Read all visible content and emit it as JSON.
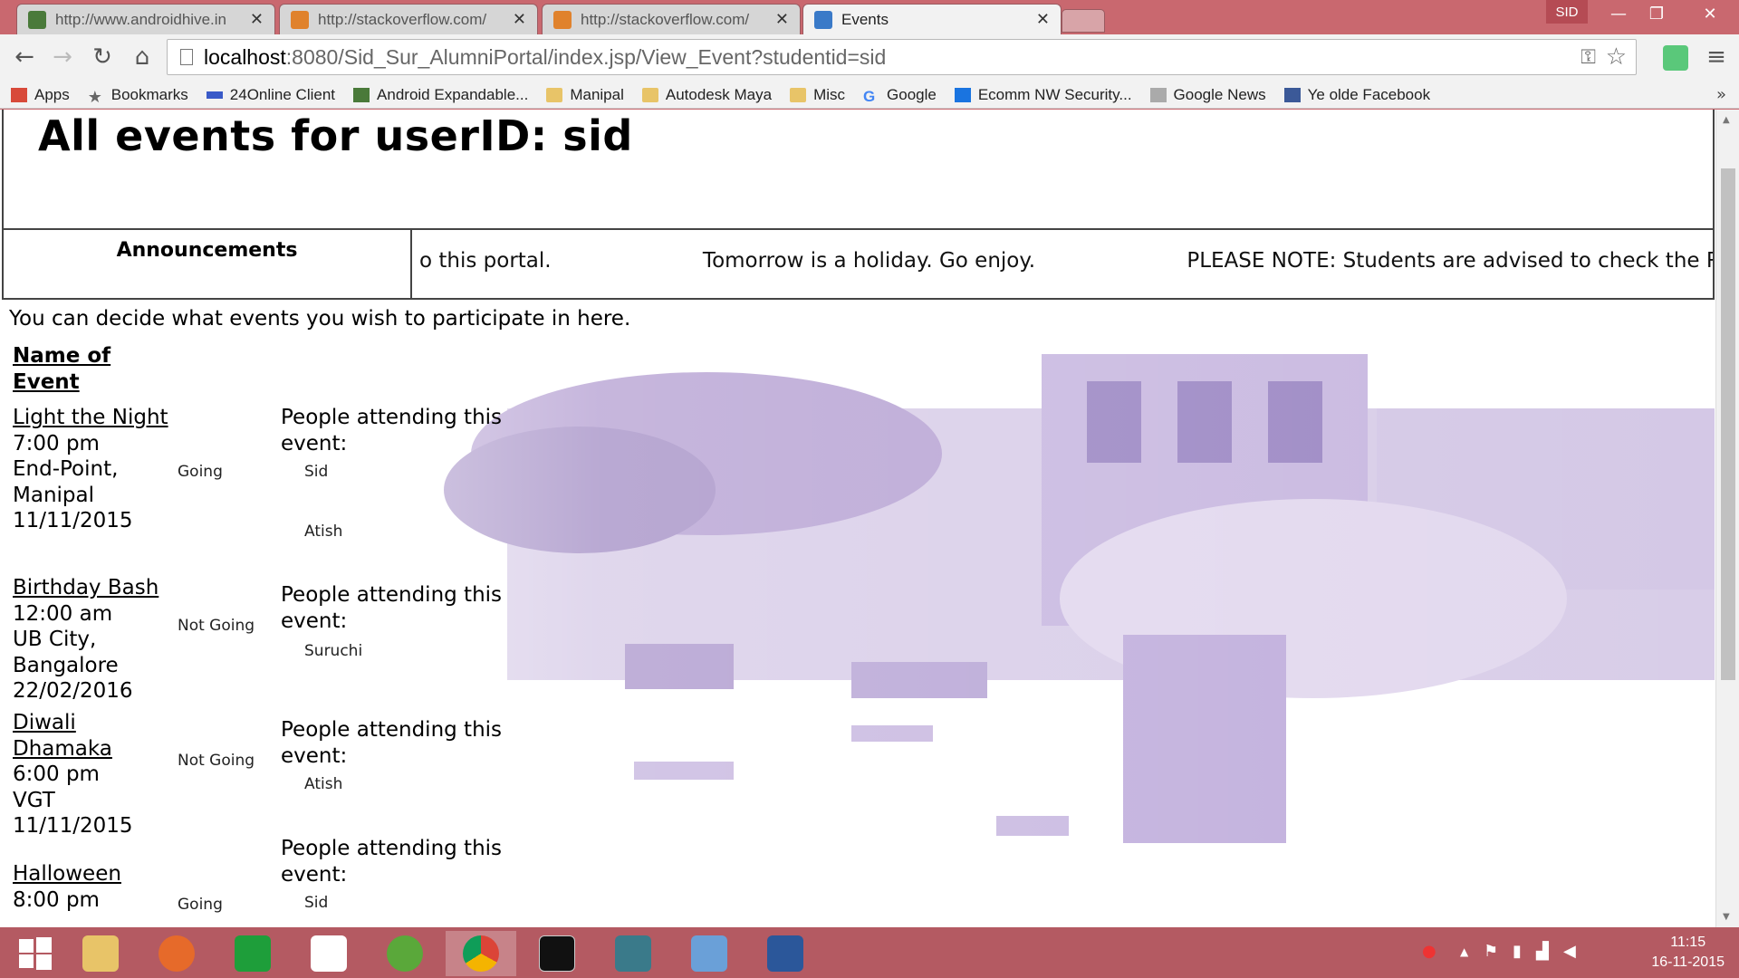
{
  "tabs": [
    {
      "title": "http://www.androidhive.in",
      "favicon_color": "#4a7a3a",
      "active": false
    },
    {
      "title": "http://stackoverflow.com/",
      "favicon_color": "#e0822c",
      "active": false
    },
    {
      "title": "http://stackoverflow.com/",
      "favicon_color": "#e0822c",
      "active": false
    },
    {
      "title": "Events",
      "favicon_color": "#3a7ac8",
      "active": true
    }
  ],
  "profile": "SID",
  "window_controls": {
    "minimize": "—",
    "maximize": "❐",
    "close": "✕"
  },
  "toolbar": {
    "back": "←",
    "forward": "→",
    "reload": "↻",
    "home": "⌂",
    "url_host": "localhost",
    "url_rest": ":8080/Sid_Sur_AlumniPortal/index.jsp/View_Event?studentid=sid",
    "menu": "≡"
  },
  "bookmarks": [
    {
      "label": "Apps",
      "icon": "apps-icon",
      "color": "#d84a3a"
    },
    {
      "label": "Bookmarks",
      "icon": "star-icon",
      "color": "#666"
    },
    {
      "label": "24Online Client",
      "icon": "cloud-icon",
      "color": "#3a5ac8"
    },
    {
      "label": "Android Expandable...",
      "icon": "android-icon",
      "color": "#4a7a3a"
    },
    {
      "label": "Manipal",
      "icon": "folder-icon",
      "color": "#e8c468"
    },
    {
      "label": "Autodesk Maya",
      "icon": "folder-icon",
      "color": "#e8c468"
    },
    {
      "label": "Misc",
      "icon": "folder-icon",
      "color": "#e8c468"
    },
    {
      "label": "Google",
      "icon": "google-icon",
      "color": "#4285f4"
    },
    {
      "label": "Ecomm NW Security...",
      "icon": "dropbox-icon",
      "color": "#1a74e0"
    },
    {
      "label": "Google News",
      "icon": "news-icon",
      "color": "#888"
    },
    {
      "label": "Ye olde Facebook",
      "icon": "facebook-icon",
      "color": "#3b5998"
    }
  ],
  "bookmarks_more": "»",
  "page": {
    "heading": "All events for userID: sid",
    "announcements_label": "Announcements",
    "announcements": [
      "o this portal.",
      "Tomorrow is a holiday. Go enjoy.",
      "PLEASE NOTE: Students are advised to check the Registra"
    ],
    "intro": "You can decide what events you wish to participate in here.",
    "column_header": "Name of Event",
    "attending_label": "People attending this event:",
    "events": [
      {
        "name": "Light the Night",
        "time": "7:00 pm",
        "venue": "End-Point, Manipal",
        "date": "11/11/2015",
        "status": "Going",
        "attendees": [
          "Sid",
          "Atish"
        ]
      },
      {
        "name": "Birthday Bash",
        "time": "12:00 am",
        "venue": "UB City, Bangalore",
        "date": "22/02/2016",
        "status": "Not Going",
        "attendees": [
          "Suruchi"
        ]
      },
      {
        "name": "Diwali Dhamaka",
        "time": "6:00 pm",
        "venue": "VGT",
        "date": "11/11/2015",
        "status": "Not Going",
        "attendees": [
          "Atish"
        ]
      },
      {
        "name": "Halloween",
        "time": "8:00 pm",
        "venue": "",
        "date": "",
        "status": "Going",
        "attendees": [
          "Sid"
        ]
      }
    ]
  },
  "taskbar": {
    "apps": [
      {
        "name": "start-button",
        "color": "#ffffff"
      },
      {
        "name": "file-explorer",
        "color": "#e8c468"
      },
      {
        "name": "firefox",
        "color": "#e66a2a"
      },
      {
        "name": "store",
        "color": "#1e9e3a"
      },
      {
        "name": "dropbox",
        "color": "#1a74e0"
      },
      {
        "name": "utorrent",
        "color": "#5aa83a"
      },
      {
        "name": "chrome",
        "color": "#db4437"
      },
      {
        "name": "cmd",
        "color": "#111111"
      },
      {
        "name": "window-app",
        "color": "#3a7a8a"
      },
      {
        "name": "virtualbox",
        "color": "#6aa0d8"
      },
      {
        "name": "word",
        "color": "#2b579a"
      }
    ],
    "time": "11:15",
    "date": "16-11-2015"
  }
}
